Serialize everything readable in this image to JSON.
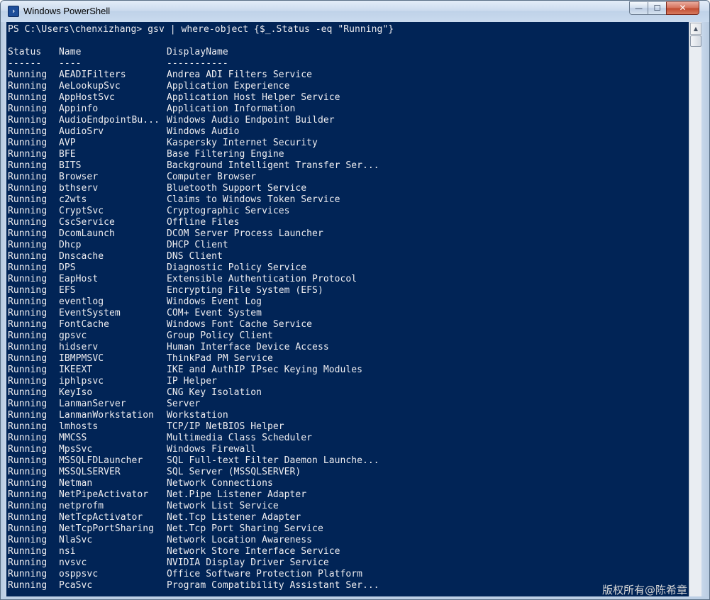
{
  "window": {
    "title": "Windows PowerShell",
    "app_icon_glyph": "›",
    "controls": {
      "minimize": "—",
      "maximize": "☐",
      "close": "✕"
    }
  },
  "console": {
    "background": "#012456",
    "foreground": "#eeedf0",
    "prompt_line": "PS C:\\Users\\chenxizhang> gsv | where-object {$_.Status -eq \"Running\"}",
    "headers": [
      "Status",
      "Name",
      "DisplayName"
    ],
    "underlines": [
      "------",
      "----",
      "-----------"
    ],
    "rows": [
      [
        "Running",
        "AEADIFilters",
        "Andrea ADI Filters Service"
      ],
      [
        "Running",
        "AeLookupSvc",
        "Application Experience"
      ],
      [
        "Running",
        "AppHostSvc",
        "Application Host Helper Service"
      ],
      [
        "Running",
        "Appinfo",
        "Application Information"
      ],
      [
        "Running",
        "AudioEndpointBu...",
        "Windows Audio Endpoint Builder"
      ],
      [
        "Running",
        "AudioSrv",
        "Windows Audio"
      ],
      [
        "Running",
        "AVP",
        "Kaspersky Internet Security"
      ],
      [
        "Running",
        "BFE",
        "Base Filtering Engine"
      ],
      [
        "Running",
        "BITS",
        "Background Intelligent Transfer Ser..."
      ],
      [
        "Running",
        "Browser",
        "Computer Browser"
      ],
      [
        "Running",
        "bthserv",
        "Bluetooth Support Service"
      ],
      [
        "Running",
        "c2wts",
        "Claims to Windows Token Service"
      ],
      [
        "Running",
        "CryptSvc",
        "Cryptographic Services"
      ],
      [
        "Running",
        "CscService",
        "Offline Files"
      ],
      [
        "Running",
        "DcomLaunch",
        "DCOM Server Process Launcher"
      ],
      [
        "Running",
        "Dhcp",
        "DHCP Client"
      ],
      [
        "Running",
        "Dnscache",
        "DNS Client"
      ],
      [
        "Running",
        "DPS",
        "Diagnostic Policy Service"
      ],
      [
        "Running",
        "EapHost",
        "Extensible Authentication Protocol"
      ],
      [
        "Running",
        "EFS",
        "Encrypting File System (EFS)"
      ],
      [
        "Running",
        "eventlog",
        "Windows Event Log"
      ],
      [
        "Running",
        "EventSystem",
        "COM+ Event System"
      ],
      [
        "Running",
        "FontCache",
        "Windows Font Cache Service"
      ],
      [
        "Running",
        "gpsvc",
        "Group Policy Client"
      ],
      [
        "Running",
        "hidserv",
        "Human Interface Device Access"
      ],
      [
        "Running",
        "IBMPMSVC",
        "ThinkPad PM Service"
      ],
      [
        "Running",
        "IKEEXT",
        "IKE and AuthIP IPsec Keying Modules"
      ],
      [
        "Running",
        "iphlpsvc",
        "IP Helper"
      ],
      [
        "Running",
        "KeyIso",
        "CNG Key Isolation"
      ],
      [
        "Running",
        "LanmanServer",
        "Server"
      ],
      [
        "Running",
        "LanmanWorkstation",
        "Workstation"
      ],
      [
        "Running",
        "lmhosts",
        "TCP/IP NetBIOS Helper"
      ],
      [
        "Running",
        "MMCSS",
        "Multimedia Class Scheduler"
      ],
      [
        "Running",
        "MpsSvc",
        "Windows Firewall"
      ],
      [
        "Running",
        "MSSQLFDLauncher",
        "SQL Full-text Filter Daemon Launche..."
      ],
      [
        "Running",
        "MSSQLSERVER",
        "SQL Server (MSSQLSERVER)"
      ],
      [
        "Running",
        "Netman",
        "Network Connections"
      ],
      [
        "Running",
        "NetPipeActivator",
        "Net.Pipe Listener Adapter"
      ],
      [
        "Running",
        "netprofm",
        "Network List Service"
      ],
      [
        "Running",
        "NetTcpActivator",
        "Net.Tcp Listener Adapter"
      ],
      [
        "Running",
        "NetTcpPortSharing",
        "Net.Tcp Port Sharing Service"
      ],
      [
        "Running",
        "NlaSvc",
        "Network Location Awareness"
      ],
      [
        "Running",
        "nsi",
        "Network Store Interface Service"
      ],
      [
        "Running",
        "nvsvc",
        "NVIDIA Display Driver Service"
      ],
      [
        "Running",
        "osppsvc",
        "Office Software Protection Platform"
      ],
      [
        "Running",
        "PcaSvc",
        "Program Compatibility Assistant Ser..."
      ]
    ]
  },
  "scrollbar": {
    "up_glyph": "▲"
  },
  "watermark": "版权所有@陈希章"
}
